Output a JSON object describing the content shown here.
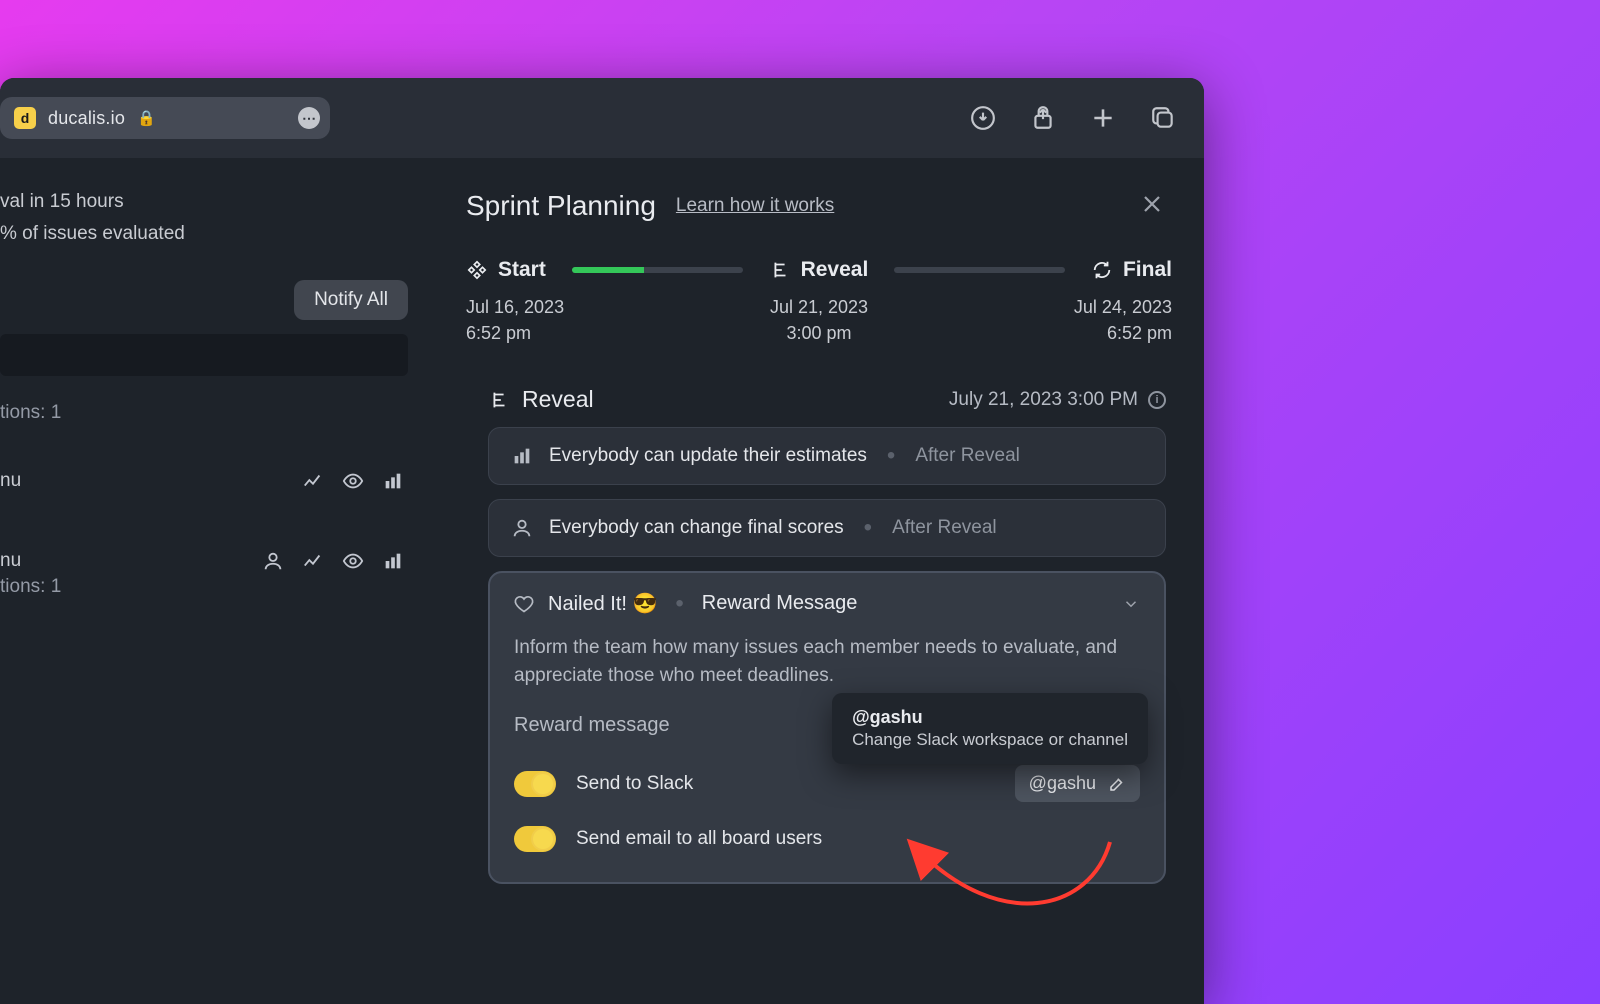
{
  "browser": {
    "favicon_letter": "d",
    "url": "ducalis.io",
    "toolbar_icons": [
      "downloads",
      "share",
      "new-tab",
      "tabs"
    ]
  },
  "left": {
    "line1": "val in 15 hours",
    "line2": "% of issues evaluated",
    "notify_btn": "Notify All",
    "questions_label": "tions: 1",
    "item_label": "nu",
    "item2_label": "nu",
    "item2_sub": "tions: 1"
  },
  "panel": {
    "title": "Sprint Planning",
    "learn_link": "Learn how it works",
    "timeline": {
      "start": {
        "label": "Start",
        "date": "Jul 16, 2023",
        "time": "6:52 pm"
      },
      "reveal": {
        "label": "Reveal",
        "date": "Jul 21, 2023",
        "time": "3:00 pm"
      },
      "final": {
        "label": "Final",
        "date": "Jul 24, 2023",
        "time": "6:52 pm"
      },
      "progress_pct": 42
    },
    "reveal": {
      "title": "Reveal",
      "date": "July 21, 2023 3:00 PM",
      "rows": [
        {
          "icon": "estimates",
          "label": "Everybody can update their estimates",
          "aux": "After Reveal"
        },
        {
          "icon": "scores",
          "label": "Everybody can change final scores",
          "aux": "After Reveal"
        }
      ]
    },
    "reward": {
      "title_a": "Nailed It! 😎",
      "title_b": "Reward Message",
      "desc": "Inform the team how many issues each member needs to evaluate, and appreciate those who meet deadlines.",
      "sublabel": "Reward message",
      "toggle_slack": "Send to Slack",
      "slack_chip": "@gashu",
      "toggle_email": "Send email to all board users",
      "tooltip": {
        "head": "@gashu",
        "sub": "Change Slack workspace or channel"
      }
    }
  }
}
